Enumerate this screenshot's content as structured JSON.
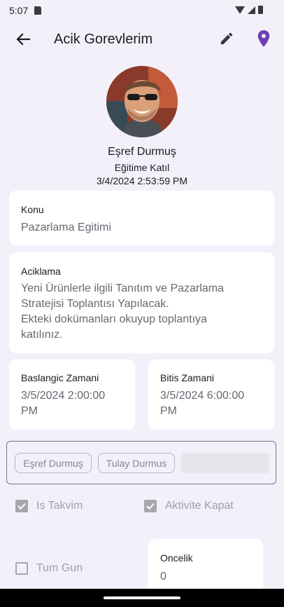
{
  "status_bar": {
    "time": "5:07"
  },
  "app_bar": {
    "title": "Acik Gorevlerim",
    "back_icon": "arrow-left-icon",
    "edit_icon": "pencil-icon",
    "location_icon": "map-pin-icon",
    "accent_color": "#6f3fb5"
  },
  "profile": {
    "name": "Eşref Durmuş",
    "subtitle": "Eğitime Katıl",
    "date": "3/4/2024 2:53:59 PM"
  },
  "konu": {
    "label": "Konu",
    "value": "Pazarlama Egitimi"
  },
  "aciklama": {
    "label": "Aciklama",
    "value": "Yeni Ürünlerle ilgili Tanıtım ve Pazarlama\nStratejisi Toplantısı Yapılacak.\nEkteki dokümanları okuyup toplantıya\nkatılınız."
  },
  "baslangic": {
    "label": "Baslangic Zamani",
    "value": "3/5/2024 2:00:00\nPM"
  },
  "bitis": {
    "label": "Bitis Zamani",
    "value": "3/5/2024 6:00:00\nPM"
  },
  "assignees": [
    "Eşref Durmuş",
    "Tulay Durmus"
  ],
  "checks": {
    "is_takvim": {
      "label": "Is Takvim",
      "checked": true
    },
    "aktivite_kapat": {
      "label": "Aktivite Kapat",
      "checked": true
    },
    "tum_gun": {
      "label": "Tum Gun",
      "checked": false
    }
  },
  "oncelik": {
    "label": "Oncelik",
    "value": "0"
  }
}
